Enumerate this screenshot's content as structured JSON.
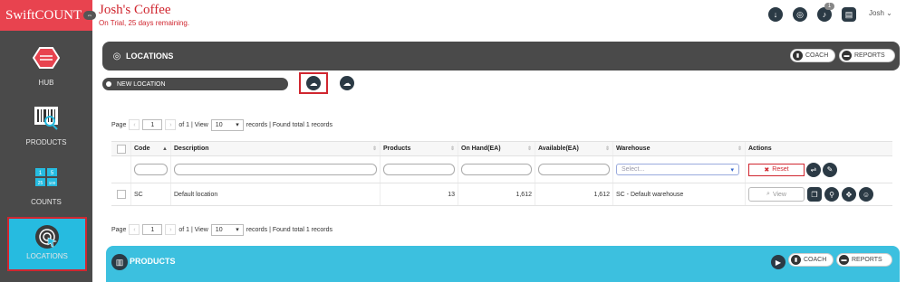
{
  "app": {
    "brand": "SwiftCOUNT",
    "company": "Josh's Coffee",
    "trial_notice": "On Trial, 25 days remaining.",
    "user": "Josh",
    "notification_count": "1"
  },
  "rail": {
    "items": [
      {
        "label": "HUB",
        "icon": "hub-icon"
      },
      {
        "label": "PRODUCTS",
        "icon": "barcode-icon"
      },
      {
        "label": "COUNTS",
        "icon": "counts-icon",
        "tiles": [
          "1",
          "5",
          "25",
          "100"
        ]
      },
      {
        "label": "LOCATIONS",
        "icon": "locations-icon",
        "active": true
      }
    ]
  },
  "locations": {
    "title": "LOCATIONS",
    "coach": "COACH",
    "reports": "REPORTS",
    "new_location": "NEW LOCATION",
    "pager": {
      "page_label": "Page",
      "page": "1",
      "of_text": "of 1 | View",
      "page_size": "10",
      "records_text": "records | Found total 1 records"
    },
    "columns": [
      "Code",
      "Description",
      "Products",
      "On Hand(EA)",
      "Available(EA)",
      "Warehouse",
      "Actions"
    ],
    "filter": {
      "warehouse_placeholder": "Select...",
      "reset": "Reset"
    },
    "rows": [
      {
        "code": "SC",
        "description": "Default location",
        "products": "13",
        "on_hand": "1,612",
        "available": "1,612",
        "warehouse": "SC - Default warehouse",
        "view": "View"
      }
    ]
  },
  "products": {
    "title": "PRODUCTS",
    "coach": "COACH",
    "reports": "REPORTS"
  },
  "colors": {
    "brand_red": "#e8434f",
    "rail_dark": "#4a4a4a",
    "accent_cyan": "#3cc0df",
    "alert_red": "#d0262f"
  }
}
